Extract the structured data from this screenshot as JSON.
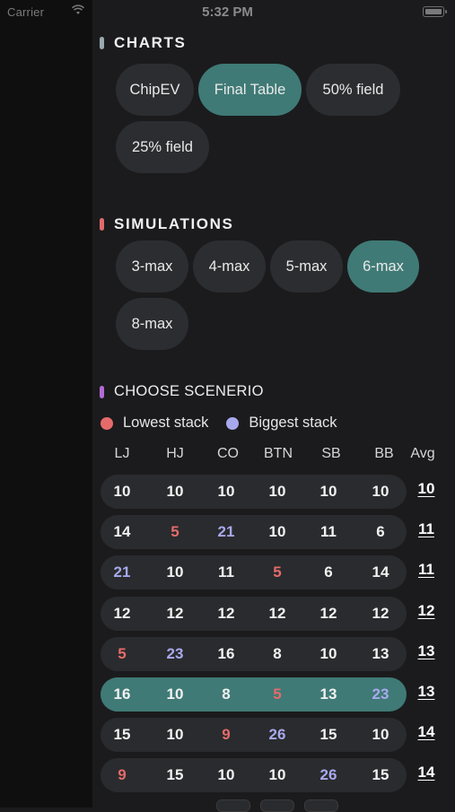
{
  "status_bar": {
    "carrier": "Carrier",
    "time": "5:32 PM"
  },
  "charts": {
    "title": "CHARTS",
    "marker_color": "#9aa8b0",
    "options": [
      "ChipEV",
      "Final Table",
      "50% field",
      "25% field"
    ],
    "selected": "Final Table"
  },
  "simulations": {
    "title": "SIMULATIONS",
    "marker_color": "#e06b6b",
    "options": [
      "3-max",
      "4-max",
      "5-max",
      "6-max",
      "8-max"
    ],
    "selected": "6-max"
  },
  "scenario": {
    "title": "CHOOSE SCENERIO",
    "marker_color": "#b36ad6",
    "legend": {
      "lowest_label": "Lowest stack",
      "lowest_color": "#e56b6b",
      "biggest_label": "Biggest stack",
      "biggest_color": "#a8a9ec"
    },
    "headers": [
      "LJ",
      "HJ",
      "CO",
      "BTN",
      "SB",
      "BB",
      "Avg"
    ],
    "rows": [
      {
        "values": [
          "10",
          "10",
          "10",
          "10",
          "10",
          "10"
        ],
        "avg": "10",
        "low": [],
        "big": []
      },
      {
        "values": [
          "14",
          "5",
          "21",
          "10",
          "11",
          "6"
        ],
        "avg": "11",
        "low": [
          1
        ],
        "big": [
          2
        ]
      },
      {
        "values": [
          "21",
          "10",
          "11",
          "5",
          "6",
          "14"
        ],
        "avg": "11",
        "low": [
          3
        ],
        "big": [
          0
        ]
      },
      {
        "values": [
          "12",
          "12",
          "12",
          "12",
          "12",
          "12"
        ],
        "avg": "12",
        "low": [],
        "big": []
      },
      {
        "values": [
          "5",
          "23",
          "16",
          "8",
          "10",
          "13"
        ],
        "avg": "13",
        "low": [
          0
        ],
        "big": [
          1
        ]
      },
      {
        "values": [
          "16",
          "10",
          "8",
          "5",
          "13",
          "23"
        ],
        "avg": "13",
        "low": [
          3
        ],
        "big": [
          5
        ],
        "selected": true
      },
      {
        "values": [
          "15",
          "10",
          "9",
          "26",
          "15",
          "10"
        ],
        "avg": "14",
        "low": [
          2
        ],
        "big": [
          3
        ]
      },
      {
        "values": [
          "9",
          "15",
          "10",
          "10",
          "26",
          "15"
        ],
        "avg": "14",
        "low": [
          0
        ],
        "big": [
          4
        ]
      }
    ]
  }
}
